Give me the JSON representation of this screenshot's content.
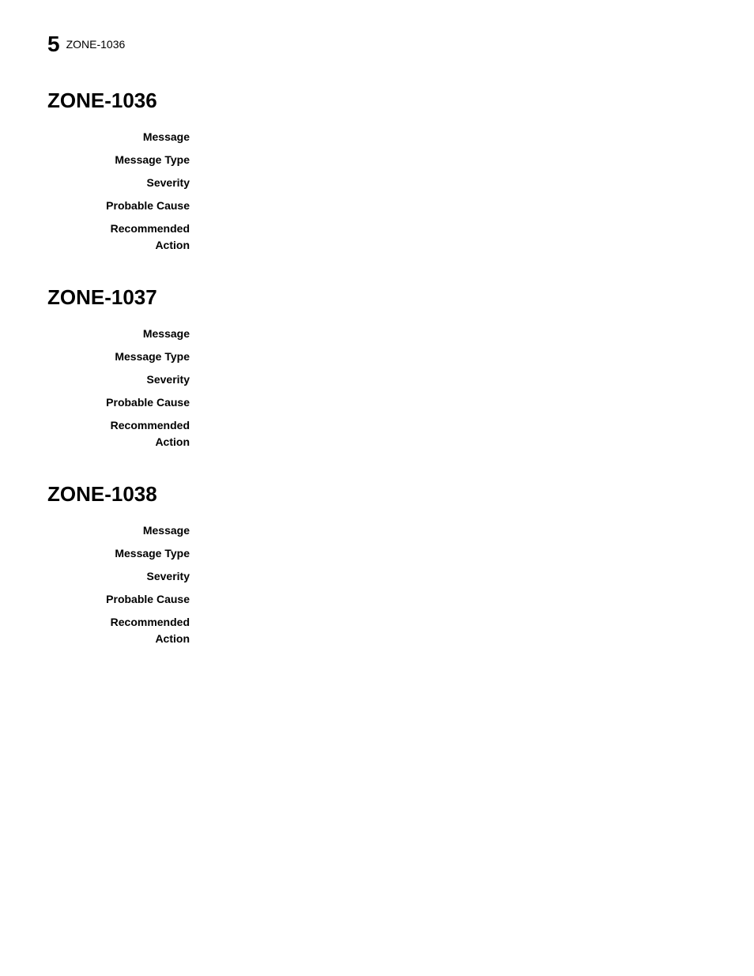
{
  "breadcrumb": {
    "number": "5",
    "title": "ZONE-1036"
  },
  "sections": [
    {
      "id": "zone-1036",
      "title": "ZONE-1036",
      "fields": [
        {
          "label": "Message",
          "value": ""
        },
        {
          "label": "Message Type",
          "value": ""
        },
        {
          "label": "Severity",
          "value": ""
        },
        {
          "label": "Probable Cause",
          "value": ""
        },
        {
          "label": "Recommended\nAction",
          "value": ""
        }
      ]
    },
    {
      "id": "zone-1037",
      "title": "ZONE-1037",
      "fields": [
        {
          "label": "Message",
          "value": ""
        },
        {
          "label": "Message Type",
          "value": ""
        },
        {
          "label": "Severity",
          "value": ""
        },
        {
          "label": "Probable Cause",
          "value": ""
        },
        {
          "label": "Recommended\nAction",
          "value": ""
        }
      ]
    },
    {
      "id": "zone-1038",
      "title": "ZONE-1038",
      "fields": [
        {
          "label": "Message",
          "value": ""
        },
        {
          "label": "Message Type",
          "value": ""
        },
        {
          "label": "Severity",
          "value": ""
        },
        {
          "label": "Probable Cause",
          "value": ""
        },
        {
          "label": "Recommended\nAction",
          "value": ""
        }
      ]
    }
  ]
}
